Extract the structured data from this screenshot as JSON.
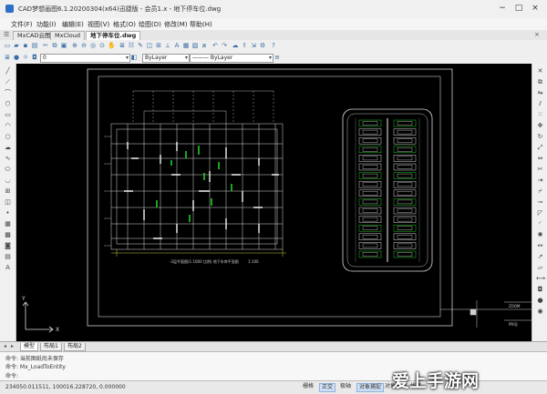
{
  "window": {
    "title": "CAD梦想画图6.1.20200304(x64)迅捷版 - 会员1.x - 地下停车位.dwg",
    "controls": [
      "−",
      "□",
      "×"
    ]
  },
  "menu": [
    "文件(F)",
    "功能(I)",
    "编辑(E)",
    "视图(V)",
    "格式(O)",
    "绘图(D)",
    "修改(M)",
    "帮助(H)"
  ],
  "tabs": [
    {
      "label": "MxCAD云图",
      "active": false
    },
    {
      "label": "MxCloud",
      "active": false
    },
    {
      "label": "地下停车位.dwg",
      "active": true
    }
  ],
  "properties": {
    "layer_value": "0",
    "color_value": "ByLayer",
    "linetype_value": "——— ByLayer"
  },
  "layout_tabs": [
    {
      "label": "模型",
      "active": true
    },
    {
      "label": "布局1",
      "active": false
    },
    {
      "label": "布局2",
      "active": false
    }
  ],
  "command": {
    "line1": "命令: 当前图纸尚未保存",
    "line2": "命令: Mx_LoadToEntity",
    "prompt": "命令:"
  },
  "status": {
    "coords": "234050.011511, 100016.228720, 0.000000",
    "buttons": [
      {
        "label": "栅格",
        "on": false
      },
      {
        "label": "正交",
        "on": true
      },
      {
        "label": "极轴",
        "on": false
      },
      {
        "label": "对象捕捉",
        "on": true
      },
      {
        "label": "对象追踪",
        "on": false
      },
      {
        "label": "线宽",
        "on": false
      }
    ]
  },
  "drawing": {
    "plan_caption": "-2层平面图(1:1000 比例) 地下车库平面图",
    "plan_scale": "1:100",
    "title_block_a": "ZOOM",
    "title_block_b": "PROJ",
    "axis_x": "X",
    "axis_y": "Y"
  },
  "watermark": "爱上手游网",
  "colors": {
    "canvas": "#000000",
    "cad_line": "#d9d9d9",
    "cad_green": "#22cc22",
    "cad_yellow": "#cccc33"
  }
}
